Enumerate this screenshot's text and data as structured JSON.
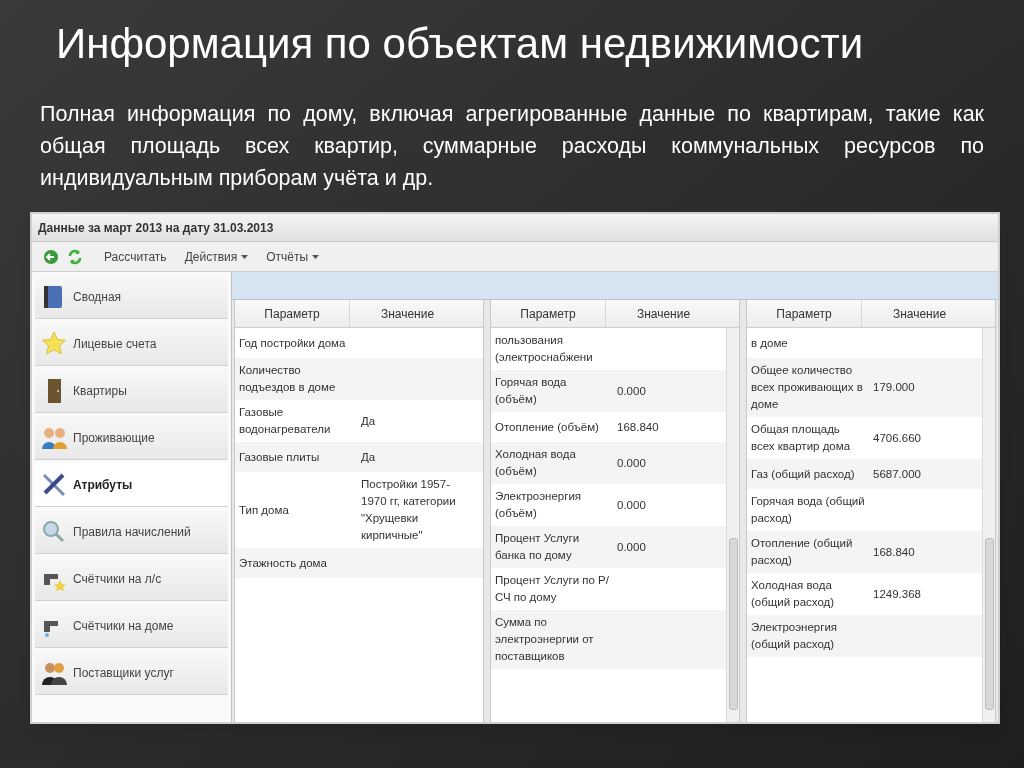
{
  "slide": {
    "title": "Информация по объектам недвижимости",
    "description": "Полная информация по дому, включая агрегированные данные по квартирам, такие как общая площадь всех квартир, суммарные расходы коммунальных ресурсов по индивидуальным приборам учёта и др."
  },
  "window": {
    "title": "Данные за март 2013 на дату 31.03.2013"
  },
  "toolbar": {
    "buttons": [
      {
        "label": "Рассчитать",
        "kind": "plain"
      },
      {
        "label": "Действия",
        "kind": "menu"
      },
      {
        "label": "Отчёты",
        "kind": "menu"
      }
    ]
  },
  "sidebar": {
    "items": [
      {
        "label": "Сводная",
        "selected": false
      },
      {
        "label": "Лицевые счета",
        "selected": false
      },
      {
        "label": "Квартиры",
        "selected": false
      },
      {
        "label": "Проживающие",
        "selected": false
      },
      {
        "label": "Атрибуты",
        "selected": true
      },
      {
        "label": "Правила начислений",
        "selected": false
      },
      {
        "label": "Счётчики на л/с",
        "selected": false
      },
      {
        "label": "Счётчики на доме",
        "selected": false
      },
      {
        "label": "Поставщики услуг",
        "selected": false
      }
    ]
  },
  "tables": [
    {
      "columns": [
        "Параметр",
        "Значение"
      ],
      "scrollbar": false,
      "rows": [
        {
          "parameter": "Год постройки дома"
        },
        {
          "parameter": "Количество подъездов в доме"
        },
        {
          "parameter": "Газовые водонагреватели",
          "value": "Да"
        },
        {
          "parameter": "Газовые плиты",
          "value": "Да"
        },
        {
          "parameter": "Тип дома",
          "value": "Постройки 1957-1970 гг, категории \"Хрущевки кирпичные\""
        },
        {
          "parameter": "Этажность дома"
        }
      ]
    },
    {
      "columns": [
        "Параметр",
        "Значение"
      ],
      "scrollbar": true,
      "rows": [
        {
          "parameter": "пользования (электроснабжени"
        },
        {
          "parameter": "Горячая вода (объём)",
          "value": "0.000"
        },
        {
          "parameter": "Отопление (объём)",
          "value": "168.840"
        },
        {
          "parameter": "Холодная вода (объём)",
          "value": "0.000"
        },
        {
          "parameter": "Электроэнергия (объём)",
          "value": "0.000"
        },
        {
          "parameter": "Процент Услуги банка по дому",
          "value": "0.000"
        },
        {
          "parameter": "Процент Услуги по Р/СЧ по дому"
        },
        {
          "parameter": "Сумма по электроэнергии от поставщиков"
        }
      ]
    },
    {
      "columns": [
        "Параметр",
        "Значение"
      ],
      "scrollbar": true,
      "rows": [
        {
          "parameter": "в доме"
        },
        {
          "parameter": "Общее количество всех проживающих в доме",
          "value": "179.000"
        },
        {
          "parameter": "Общая площадь всех квартир дома",
          "value": "4706.660"
        },
        {
          "parameter": "Газ (общий расход)",
          "value": "5687.000"
        },
        {
          "parameter": "Горячая вода (общий расход)"
        },
        {
          "parameter": "Отопление (общий расход)",
          "value": "168.840"
        },
        {
          "parameter": "Холодная вода (общий расход)",
          "value": "1249.368"
        },
        {
          "parameter": "Электроэнергия (общий расход)"
        }
      ]
    }
  ]
}
